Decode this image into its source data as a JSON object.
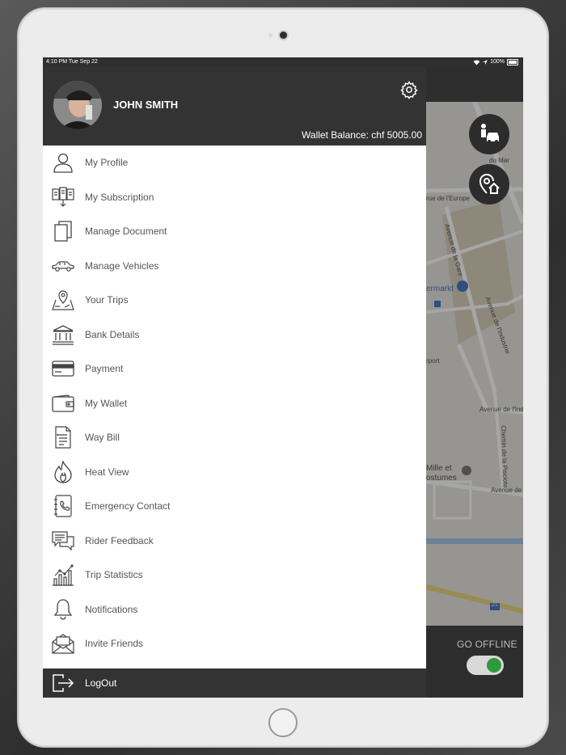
{
  "status_bar": {
    "time": "4:10 PM  Tue Sep 22",
    "battery": "100%"
  },
  "drawer": {
    "user_name": "JOHN SMITH",
    "wallet_balance": "Wallet Balance:  chf 5005.00",
    "menu_items": [
      {
        "label": "My Profile",
        "icon": "profile-icon"
      },
      {
        "label": "My Subscription",
        "icon": "subscription-icon"
      },
      {
        "label": "Manage Document",
        "icon": "document-icon"
      },
      {
        "label": "Manage Vehicles",
        "icon": "vehicle-icon"
      },
      {
        "label": "Your Trips",
        "icon": "trips-map-icon"
      },
      {
        "label": "Bank Details",
        "icon": "bank-icon"
      },
      {
        "label": "Payment",
        "icon": "card-icon"
      },
      {
        "label": "My Wallet",
        "icon": "wallet-icon"
      },
      {
        "label": "Way Bill",
        "icon": "waybill-icon"
      },
      {
        "label": "Heat View",
        "icon": "flame-icon"
      },
      {
        "label": "Emergency Contact",
        "icon": "phone-book-icon"
      },
      {
        "label": "Rider Feedback",
        "icon": "feedback-icon"
      },
      {
        "label": "Trip Statistics",
        "icon": "statistics-icon"
      },
      {
        "label": "Notifications",
        "icon": "bell-icon"
      },
      {
        "label": "Invite Friends",
        "icon": "envelope-icon"
      }
    ],
    "logout_label": "LogOut"
  },
  "map": {
    "labels": [
      "du Mar",
      "rue de l'Europe",
      "Avenue de la Gare",
      "ermarkt",
      "Avenue de l'Industrie",
      "rport",
      "Avenue de l'Ind",
      "Chemin de la Pisciote",
      "Mille et",
      "ostumes",
      "Avenue de",
      "21"
    ]
  },
  "bottom_bar": {
    "go_offline_label": "GO OFFLINE",
    "toggle_on": true
  },
  "colors": {
    "header": "#333333",
    "toggle_knob": "#2f9a3c"
  }
}
